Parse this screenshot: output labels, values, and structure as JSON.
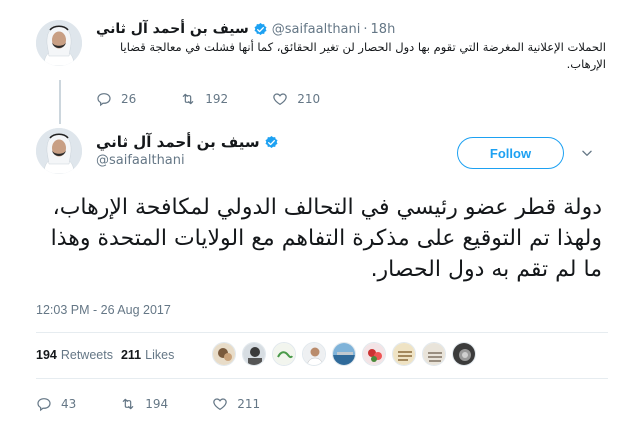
{
  "parent_tweet": {
    "author_name": "سيف بن أحمد آل ثاني",
    "handle": "@saifaalthani",
    "separator": "·",
    "time": "18h",
    "text": "الحملات الإعلانية المغرضة التي تقوم بها دول الحصار لن تغير الحقائق، كما أنها فشلت في معالجة قضايا الإرهاب.",
    "reply_count": "26",
    "retweet_count": "192",
    "like_count": "210"
  },
  "main_tweet": {
    "author_name": "سيف بن أحمد آل ثاني",
    "handle": "@saifaalthani",
    "follow_label": "Follow",
    "text": "دولة قطر عضو رئيسي في التحالف الدولي لمكافحة الإرهاب، ولهذا تم التوقيع على مذكرة التفاهم مع الولايات المتحدة وهذا ما لم تقم به دول الحصار.",
    "timestamp": "12:03 PM - 26 Aug 2017",
    "retweets_count": "194",
    "retweets_label": "Retweets",
    "likes_count": "211",
    "likes_label": "Likes",
    "reply_count": "43",
    "retweet_count": "194",
    "like_count": "211"
  },
  "colors": {
    "accent": "#1da1f2",
    "muted": "#657786",
    "text": "#14171a"
  },
  "icons": [
    "verified-badge-icon",
    "reply-icon",
    "retweet-icon",
    "like-icon",
    "chevron-down-icon"
  ]
}
